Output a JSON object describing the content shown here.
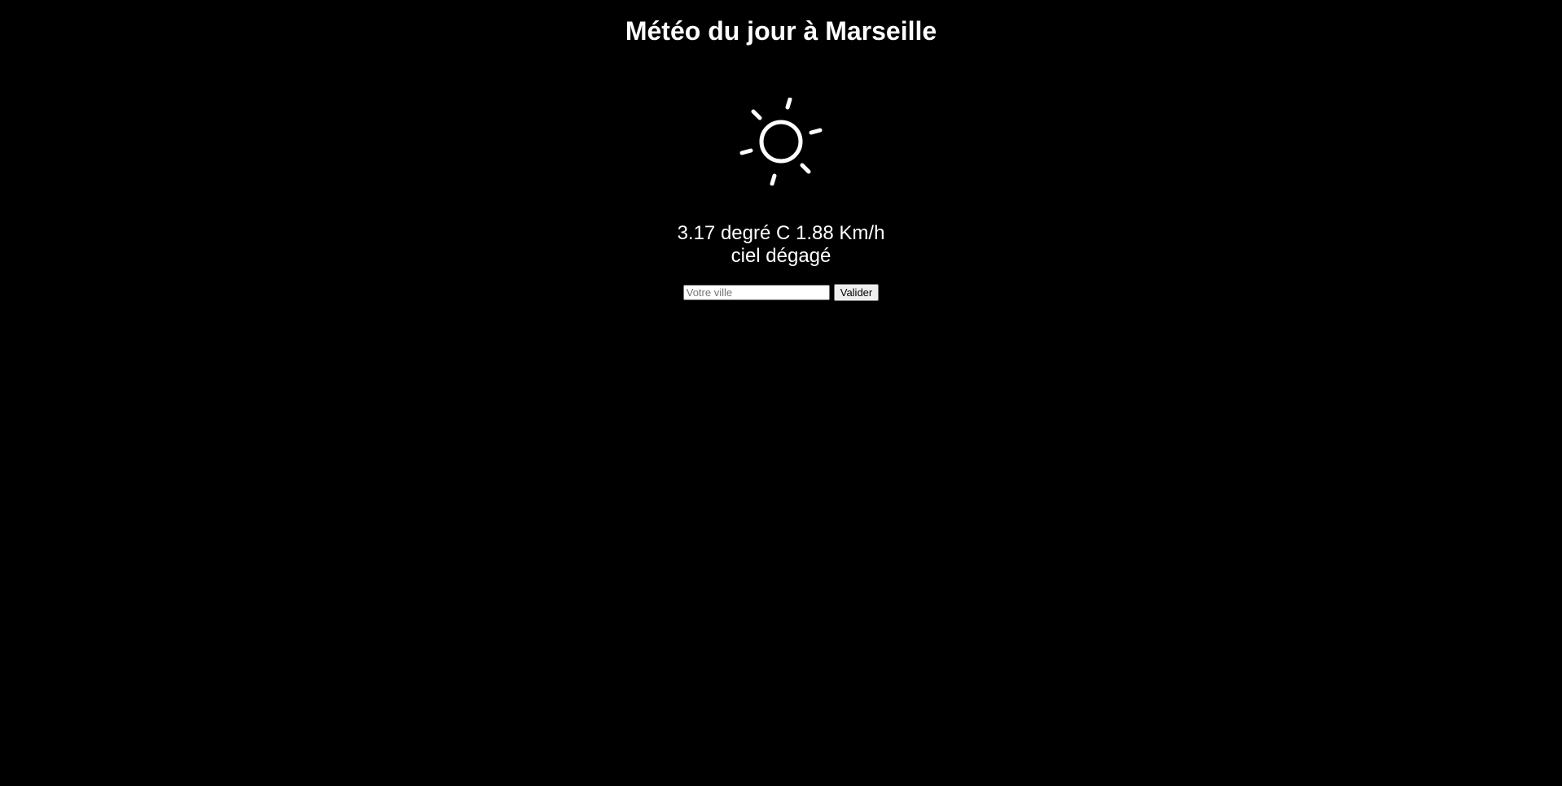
{
  "header": {
    "title": "Météo du jour à Marseille"
  },
  "weather": {
    "icon": "sun-icon",
    "temperature": "3.17",
    "temperature_unit": "degré C",
    "wind_speed": "1.88",
    "wind_unit": "Km/h",
    "description": "ciel dégagé"
  },
  "form": {
    "city_placeholder": "Votre ville",
    "city_value": "",
    "submit_label": "Valider"
  },
  "colors": {
    "background": "#000000",
    "text": "#ffffff"
  }
}
